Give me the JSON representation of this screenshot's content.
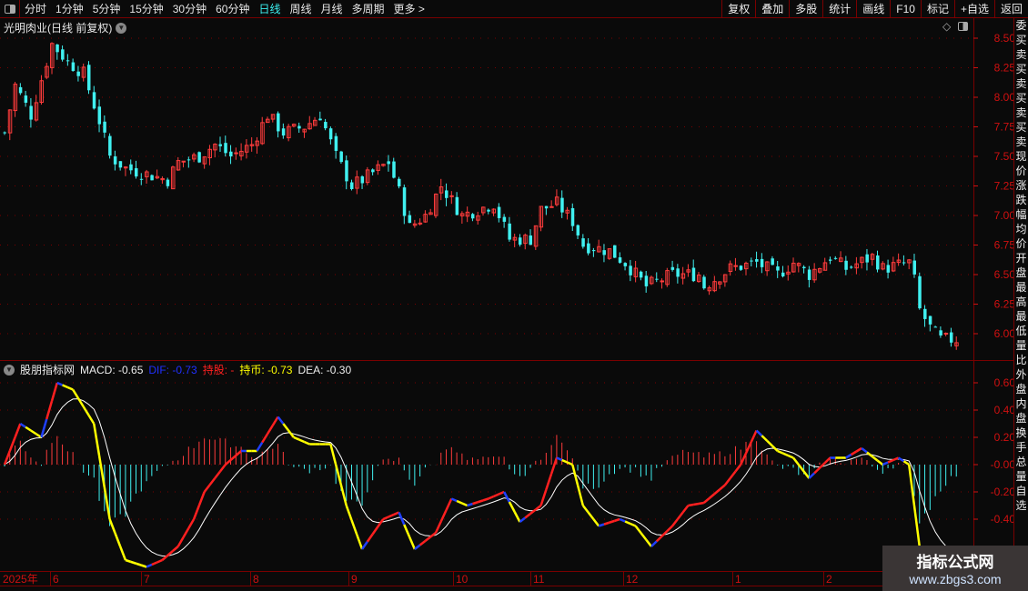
{
  "toolbar": {
    "periods": [
      "分时",
      "1分钟",
      "5分钟",
      "15分钟",
      "30分钟",
      "60分钟",
      "日线",
      "周线",
      "月线",
      "多周期",
      "更多 >"
    ],
    "active": "日线",
    "right_buttons": [
      "复权",
      "叠加",
      "多股",
      "统计",
      "画线",
      "F10",
      "标记",
      "+自选",
      "返回"
    ]
  },
  "chart_title": "光明肉业(日线 前复权)",
  "price_axis": {
    "ticks": [
      "8.50",
      "8.25",
      "8.00",
      "7.75",
      "7.50",
      "7.25",
      "7.00",
      "6.75",
      "6.50",
      "6.25",
      "6.00"
    ],
    "max": 8.5,
    "min": 6.0
  },
  "macd_legend": {
    "name": "股朋指标网",
    "macd": "MACD: -0.65",
    "dif": "DIF: -0.73",
    "hold": "持股: -",
    "cash": "持币: -0.73",
    "dea": "DEA: -0.30"
  },
  "macd_axis": {
    "ticks": [
      "0.60",
      "0.40",
      "0.20",
      "-0.00",
      "-0.20",
      "-0.40"
    ]
  },
  "date_axis": {
    "labels": [
      "2025年",
      "6",
      "7",
      "8",
      "9",
      "10",
      "11",
      "12",
      "1",
      "2"
    ]
  },
  "right_strip": "委买卖买卖买卖买卖现价涨跌幅均价开盘最高最低量比外盘内盘换手总量自选",
  "watermark": {
    "title": "指标公式网",
    "url": "www.zbgs3.com"
  },
  "colors": {
    "up": "#ff3c3c",
    "down": "#40f0f0",
    "grid": "#7a0000",
    "axis": "#d01010",
    "dea": "#ffffff",
    "dif_up": "#ff2020",
    "dif_down": "#ffff00",
    "dif_turn": "#2040ff"
  },
  "chart_data": {
    "type": "candlestick+macd",
    "candle_count": 182,
    "close_keypoints": [
      [
        0,
        7.7
      ],
      [
        2,
        8.1
      ],
      [
        5,
        7.85
      ],
      [
        9,
        8.45
      ],
      [
        12,
        8.3
      ],
      [
        15,
        8.2
      ],
      [
        18,
        7.8
      ],
      [
        20,
        7.5
      ],
      [
        23,
        7.4
      ],
      [
        27,
        7.35
      ],
      [
        31,
        7.3
      ],
      [
        33,
        7.45
      ],
      [
        37,
        7.5
      ],
      [
        40,
        7.6
      ],
      [
        43,
        7.5
      ],
      [
        47,
        7.6
      ],
      [
        50,
        7.85
      ],
      [
        53,
        7.7
      ],
      [
        57,
        7.75
      ],
      [
        60,
        7.85
      ],
      [
        63,
        7.5
      ],
      [
        66,
        7.25
      ],
      [
        68,
        7.3
      ],
      [
        73,
        7.45
      ],
      [
        75,
        7.2
      ],
      [
        77,
        6.9
      ],
      [
        80,
        7.0
      ],
      [
        83,
        7.25
      ],
      [
        87,
        7.0
      ],
      [
        90,
        7.05
      ],
      [
        93,
        7.1
      ],
      [
        96,
        6.8
      ],
      [
        100,
        6.8
      ],
      [
        102,
        7.05
      ],
      [
        105,
        7.1
      ],
      [
        108,
        6.95
      ],
      [
        110,
        6.75
      ],
      [
        115,
        6.7
      ],
      [
        118,
        6.6
      ],
      [
        122,
        6.4
      ],
      [
        127,
        6.5
      ],
      [
        132,
        6.5
      ],
      [
        133,
        6.4
      ],
      [
        138,
        6.55
      ],
      [
        143,
        6.6
      ],
      [
        147,
        6.5
      ],
      [
        150,
        6.6
      ],
      [
        153,
        6.5
      ],
      [
        157,
        6.65
      ],
      [
        160,
        6.55
      ],
      [
        165,
        6.65
      ],
      [
        167,
        6.55
      ],
      [
        172,
        6.6
      ],
      [
        173,
        6.45
      ],
      [
        174,
        6.2
      ],
      [
        176,
        6.05
      ],
      [
        178,
        5.95
      ]
    ],
    "dif_keypoints": [
      [
        0,
        0.0
      ],
      [
        3,
        0.3
      ],
      [
        7,
        0.2
      ],
      [
        10,
        0.6
      ],
      [
        13,
        0.55
      ],
      [
        17,
        0.3
      ],
      [
        20,
        -0.4
      ],
      [
        23,
        -0.7
      ],
      [
        27,
        -0.75
      ],
      [
        30,
        -0.7
      ],
      [
        33,
        -0.6
      ],
      [
        36,
        -0.4
      ],
      [
        38,
        -0.2
      ],
      [
        42,
        0.0
      ],
      [
        45,
        0.1
      ],
      [
        48,
        0.1
      ],
      [
        52,
        0.35
      ],
      [
        55,
        0.2
      ],
      [
        58,
        0.15
      ],
      [
        62,
        0.15
      ],
      [
        65,
        -0.3
      ],
      [
        68,
        -0.62
      ],
      [
        72,
        -0.4
      ],
      [
        75,
        -0.35
      ],
      [
        78,
        -0.62
      ],
      [
        82,
        -0.5
      ],
      [
        85,
        -0.25
      ],
      [
        88,
        -0.3
      ],
      [
        92,
        -0.25
      ],
      [
        95,
        -0.2
      ],
      [
        98,
        -0.42
      ],
      [
        102,
        -0.3
      ],
      [
        105,
        0.05
      ],
      [
        108,
        0.0
      ],
      [
        110,
        -0.3
      ],
      [
        113,
        -0.45
      ],
      [
        117,
        -0.4
      ],
      [
        120,
        -0.45
      ],
      [
        123,
        -0.6
      ],
      [
        127,
        -0.45
      ],
      [
        130,
        -0.3
      ],
      [
        133,
        -0.28
      ],
      [
        137,
        -0.15
      ],
      [
        140,
        0.0
      ],
      [
        143,
        0.25
      ],
      [
        147,
        0.1
      ],
      [
        150,
        0.05
      ],
      [
        153,
        -0.1
      ],
      [
        157,
        0.05
      ],
      [
        160,
        0.05
      ],
      [
        163,
        0.12
      ],
      [
        167,
        0.0
      ],
      [
        170,
        0.05
      ],
      [
        172,
        0.0
      ],
      [
        174,
        -0.6
      ],
      [
        176,
        -0.73
      ]
    ],
    "macd_range": [
      -0.8,
      0.7
    ]
  }
}
